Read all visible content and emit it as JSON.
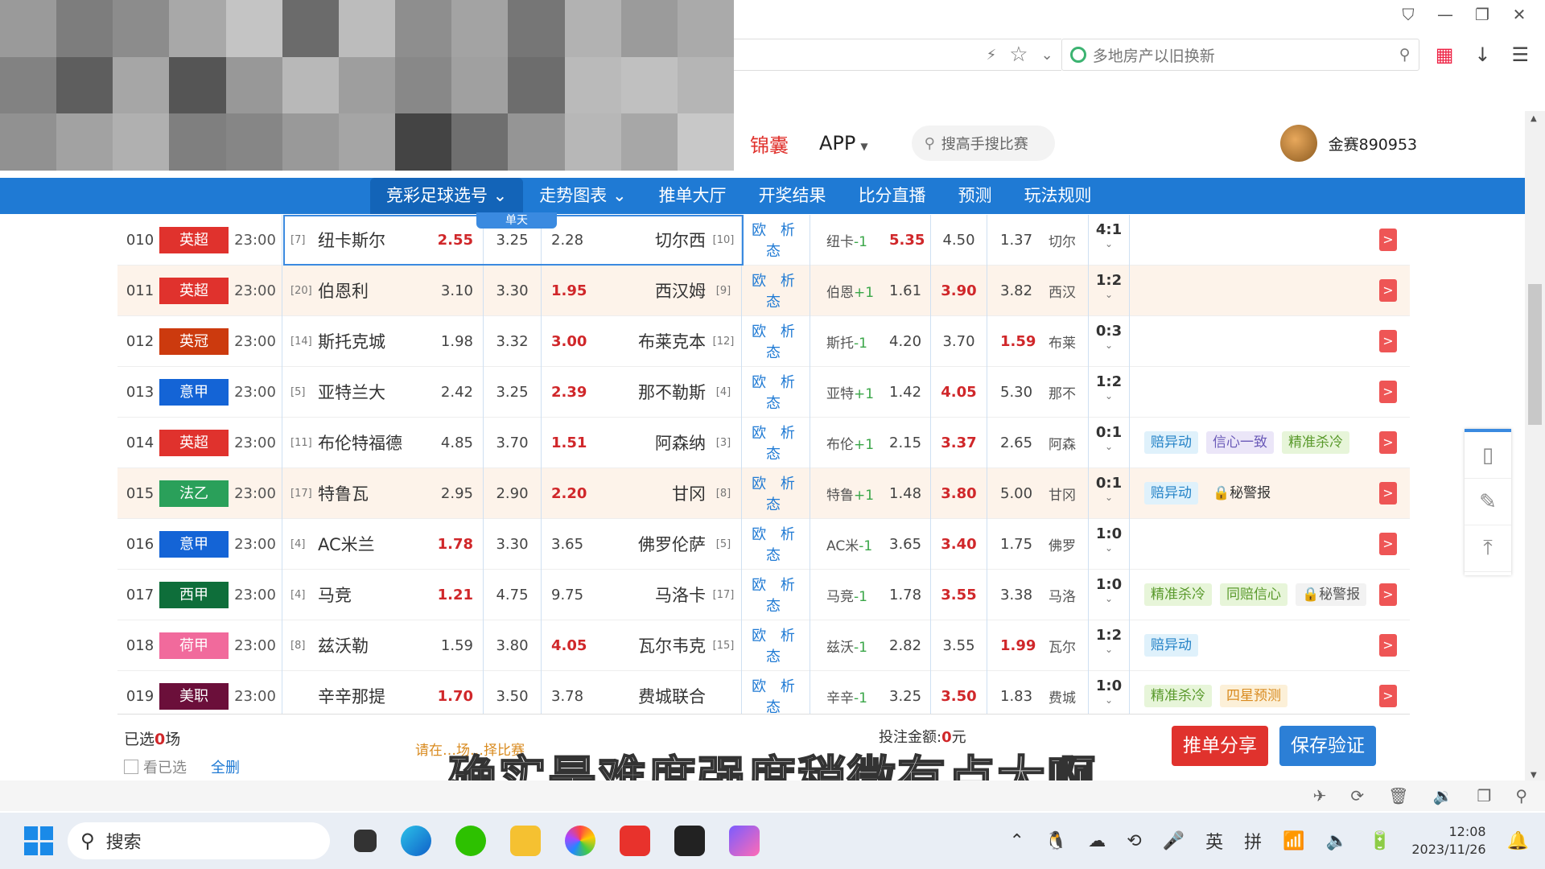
{
  "blur_colors": [
    "#9a9a9a",
    "#7d7d7d",
    "#8c8c8c",
    "#a8a8a8",
    "#c4c4c4",
    "#6b6b6b",
    "#bcbcbc",
    "#8e8e8e",
    "#a3a3a3",
    "#767676",
    "#b2b2b2",
    "#9b9b9b",
    "#aaaaaa",
    "#828282",
    "#5e5e5e",
    "#a6a6a6",
    "#555555",
    "#989898",
    "#b8b8b8",
    "#9e9e9e",
    "#888888",
    "#a0a0a0",
    "#6d6d6d",
    "#bababa",
    "#c0c0c0",
    "#b5b5b5",
    "#919191",
    "#a2a2a2",
    "#b0b0b0",
    "#7f7f7f",
    "#868686",
    "#999999",
    "#a5a5a5",
    "#444444",
    "#6f6f6f",
    "#959595",
    "#b7b7b7",
    "#a7a7a7",
    "#c8c8c8"
  ],
  "browser": {
    "search_text": "多地房产以旧换新"
  },
  "header": {
    "brand": "锦囊",
    "app_menu": "APP",
    "search_placeholder": "搜高手搜比赛",
    "username": "金赛890953"
  },
  "nav": [
    "竞彩足球选号 ⌄",
    "走势图表 ⌄",
    "推单大厅",
    "开奖结果",
    "比分直播",
    "预测",
    "玩法规则"
  ],
  "today_badge": "单天",
  "links_text": "欧 析 态",
  "matches": [
    {
      "num": "010",
      "league": "英超",
      "color": "#e0322d",
      "time": "23:00",
      "hrank": "[7]",
      "home": "纽卡斯尔",
      "h": "2.55",
      "hr": true,
      "d": "3.25",
      "a": "2.28",
      "ar": false,
      "away": "切尔西",
      "arank": "[10]",
      "hteam": "纽卡",
      "hcp": "-1",
      "ho": "5.35",
      "hor": true,
      "dd": "4.50",
      "ao": "1.37",
      "aor": false,
      "ateam": "切尔",
      "score": "4:1",
      "hl": false,
      "tags": []
    },
    {
      "num": "011",
      "league": "英超",
      "color": "#e0322d",
      "time": "23:00",
      "hrank": "[20]",
      "home": "伯恩利",
      "h": "3.10",
      "hr": false,
      "d": "3.30",
      "a": "1.95",
      "ar": true,
      "away": "西汉姆",
      "arank": "[9]",
      "hteam": "伯恩",
      "hcp": "+1",
      "ho": "1.61",
      "hor": false,
      "dd": "3.90",
      "ddr": true,
      "ao": "3.82",
      "aor": false,
      "ateam": "西汉",
      "score": "1:2",
      "hl": true,
      "tags": []
    },
    {
      "num": "012",
      "league": "英冠",
      "color": "#cc3a0e",
      "time": "23:00",
      "hrank": "[14]",
      "home": "斯托克城",
      "h": "1.98",
      "hr": false,
      "d": "3.32",
      "a": "3.00",
      "ar": true,
      "away": "布莱克本",
      "arank": "[12]",
      "hteam": "斯托",
      "hcp": "-1",
      "ho": "4.20",
      "hor": false,
      "dd": "3.70",
      "ao": "1.59",
      "aor": true,
      "ateam": "布莱",
      "score": "0:3",
      "hl": false,
      "tags": []
    },
    {
      "num": "013",
      "league": "意甲",
      "color": "#1464d6",
      "time": "23:00",
      "hrank": "[5]",
      "home": "亚特兰大",
      "h": "2.42",
      "hr": false,
      "d": "3.25",
      "a": "2.39",
      "ar": true,
      "away": "那不勒斯",
      "arank": "[4]",
      "hteam": "亚特",
      "hcp": "+1",
      "ho": "1.42",
      "hor": false,
      "dd": "4.05",
      "ddr": true,
      "ao": "5.30",
      "aor": false,
      "ateam": "那不",
      "score": "1:2",
      "hl": false,
      "tags": []
    },
    {
      "num": "014",
      "league": "英超",
      "color": "#e0322d",
      "time": "23:00",
      "hrank": "[11]",
      "home": "布伦特福德",
      "h": "4.85",
      "hr": false,
      "d": "3.70",
      "a": "1.51",
      "ar": true,
      "away": "阿森纳",
      "arank": "[3]",
      "hteam": "布伦",
      "hcp": "+1",
      "ho": "2.15",
      "hor": false,
      "dd": "3.37",
      "ddr": true,
      "ao": "2.65",
      "aor": false,
      "ateam": "阿森",
      "score": "0:1",
      "hl": false,
      "tags": [
        {
          "t": "赔异动",
          "c": "blue"
        },
        {
          "t": "信心一致",
          "c": "purple"
        },
        {
          "t": "精准杀冷",
          "c": "green"
        }
      ]
    },
    {
      "num": "015",
      "league": "法乙",
      "color": "#2aa05a",
      "time": "23:00",
      "hrank": "[17]",
      "home": "特鲁瓦",
      "h": "2.95",
      "hr": false,
      "d": "2.90",
      "a": "2.20",
      "ar": true,
      "away": "甘冈",
      "arank": "[8]",
      "hteam": "特鲁",
      "hcp": "+1",
      "ho": "1.48",
      "hor": false,
      "dd": "3.80",
      "ddr": true,
      "ao": "5.00",
      "aor": false,
      "ateam": "甘冈",
      "score": "0:1",
      "hl": true,
      "tags": [
        {
          "t": "赔异动",
          "c": "blue"
        },
        {
          "t": "🔒秘警报",
          "c": "none"
        }
      ]
    },
    {
      "num": "016",
      "league": "意甲",
      "color": "#1464d6",
      "time": "23:00",
      "hrank": "[4]",
      "home": "AC米兰",
      "h": "1.78",
      "hr": true,
      "d": "3.30",
      "a": "3.65",
      "ar": false,
      "away": "佛罗伦萨",
      "arank": "[5]",
      "hteam": "AC米",
      "hcp": "-1",
      "ho": "3.65",
      "hor": false,
      "dd": "3.40",
      "ddr": true,
      "ao": "1.75",
      "aor": false,
      "ateam": "佛罗",
      "score": "1:0",
      "hl": false,
      "tags": []
    },
    {
      "num": "017",
      "league": "西甲",
      "color": "#0e6e3a",
      "time": "23:00",
      "hrank": "[4]",
      "home": "马竞",
      "h": "1.21",
      "hr": true,
      "d": "4.75",
      "a": "9.75",
      "ar": false,
      "away": "马洛卡",
      "arank": "[17]",
      "hteam": "马竞",
      "hcp": "-1",
      "ho": "1.78",
      "hor": false,
      "dd": "3.55",
      "ddr": true,
      "ao": "3.38",
      "aor": false,
      "ateam": "马洛",
      "score": "1:0",
      "hl": false,
      "tags": [
        {
          "t": "精准杀冷",
          "c": "green"
        },
        {
          "t": "同赔信心",
          "c": "green"
        },
        {
          "t": "🔒秘警报",
          "c": "gray"
        }
      ]
    },
    {
      "num": "018",
      "league": "荷甲",
      "color": "#f16a9c",
      "time": "23:00",
      "hrank": "[8]",
      "home": "兹沃勒",
      "h": "1.59",
      "hr": false,
      "d": "3.80",
      "a": "4.05",
      "ar": true,
      "away": "瓦尔韦克",
      "arank": "[15]",
      "hteam": "兹沃",
      "hcp": "-1",
      "ho": "2.82",
      "hor": false,
      "dd": "3.55",
      "ao": "1.99",
      "aor": true,
      "ateam": "瓦尔",
      "score": "1:2",
      "hl": false,
      "tags": [
        {
          "t": "赔异动",
          "c": "blue"
        }
      ]
    },
    {
      "num": "019",
      "league": "美职",
      "color": "#6b0f3a",
      "time": "23:00",
      "hrank": "",
      "home": "辛辛那提",
      "h": "1.70",
      "hr": true,
      "d": "3.50",
      "a": "3.78",
      "ar": false,
      "away": "费城联合",
      "arank": "",
      "hteam": "辛辛",
      "hcp": "-1",
      "ho": "3.25",
      "hor": false,
      "dd": "3.50",
      "ddr": true,
      "ao": "1.83",
      "aor": false,
      "ateam": "费城",
      "score": "1:0",
      "hl": false,
      "tags": [
        {
          "t": "精准杀冷",
          "c": "green"
        },
        {
          "t": "四星预测",
          "c": "orange"
        }
      ]
    }
  ],
  "bottom": {
    "selected_prefix": "已选",
    "selected_count": "0",
    "selected_suffix": "场",
    "look_selected": "看已选",
    "delete_all": "全删",
    "hint": "请在…场…择比赛",
    "bet_label": "投注金额:",
    "bet_value": "0",
    "bet_unit": "元",
    "share": "推单分享",
    "save": "保存验证"
  },
  "subtitle": "确实是难度强度稍微有点大啊",
  "taskbar": {
    "search": "搜索",
    "ime_lang": "英",
    "ime_mode": "拼",
    "time": "12:08",
    "date": "2023/11/26"
  }
}
